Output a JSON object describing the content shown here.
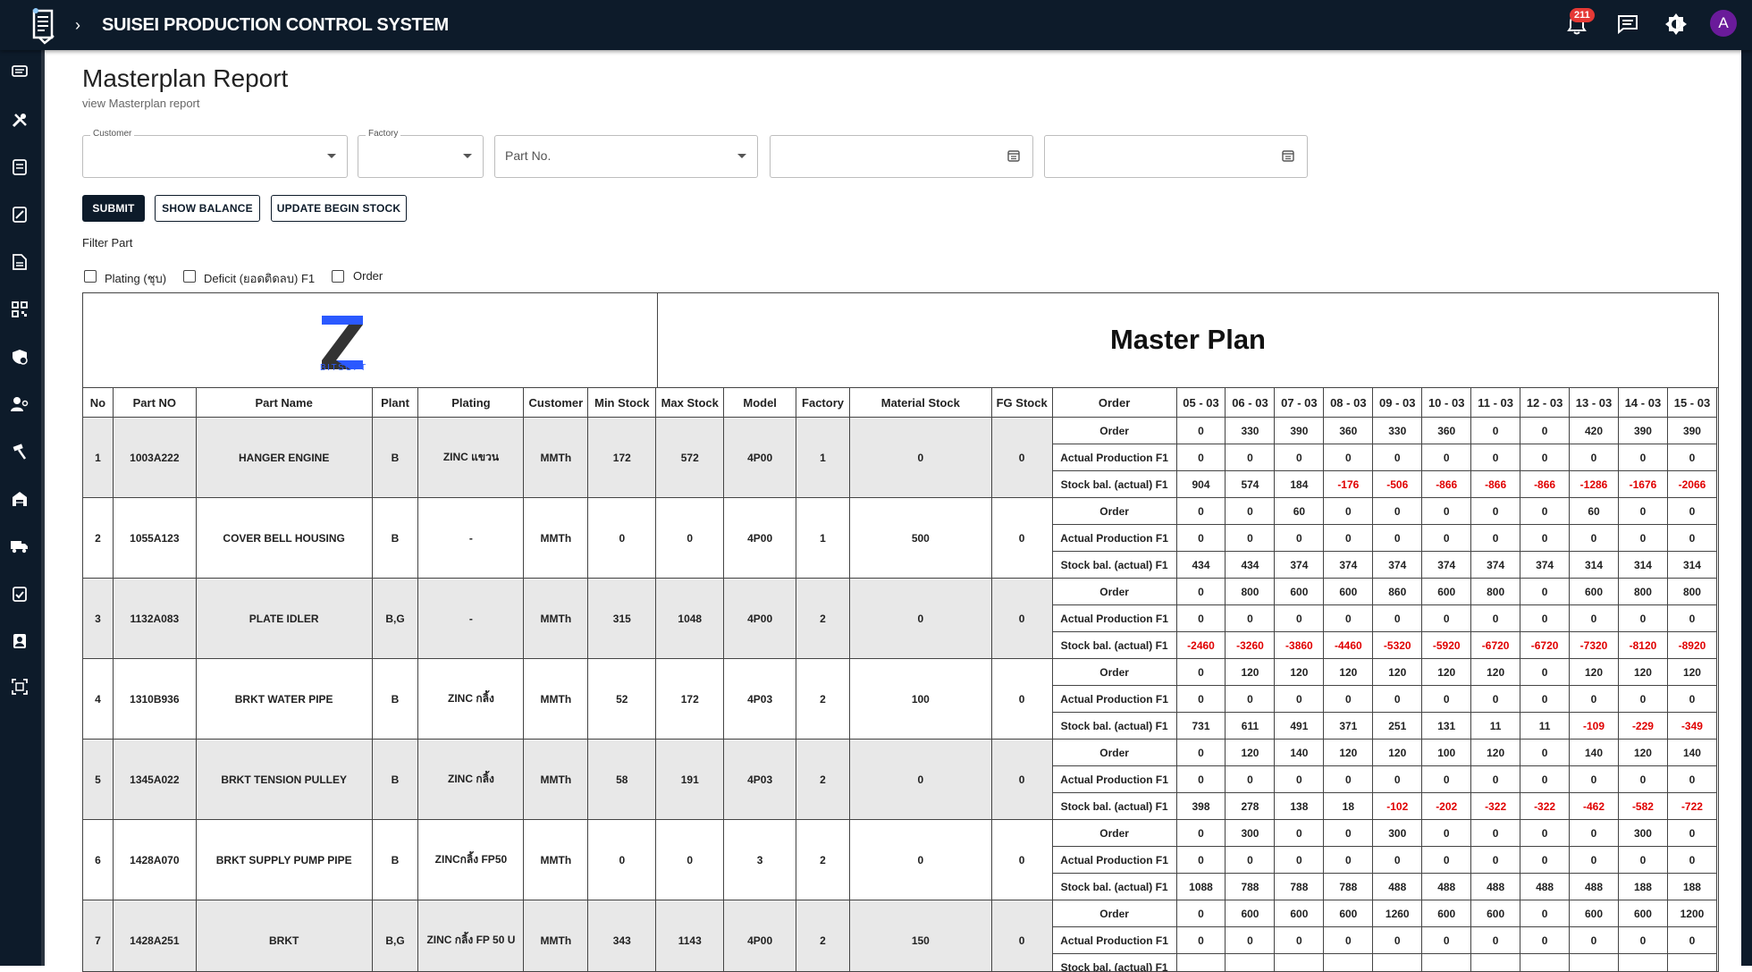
{
  "header": {
    "title": "SUISEI PRODUCTION CONTROL SYSTEM",
    "notification_count": "211",
    "avatar_letter": "A"
  },
  "page": {
    "title": "Masterplan Report",
    "subtitle": "view Masterplan report"
  },
  "filters": {
    "customer_label": "Customer",
    "factory_label": "Factory",
    "part_no_placeholder": "Part No."
  },
  "buttons": {
    "submit": "SUBMIT",
    "show_balance": "SHOW BALANCE",
    "update_begin_stock": "UPDATE BEGIN STOCK"
  },
  "filter_part": {
    "label": "Filter Part",
    "options": [
      "Plating (ชุบ)",
      "Deficit (ยอดติดลบ) F1",
      "Order"
    ]
  },
  "report": {
    "title": "Master Plan",
    "logo_text": "BITSOFT",
    "columns": [
      "No",
      "Part NO",
      "Part Name",
      "Plant",
      "Plating",
      "Customer",
      "Min Stock",
      "Max Stock",
      "Model",
      "Factory",
      "Material Stock",
      "FG Stock",
      "Order"
    ],
    "dates": [
      "05 - 03",
      "06 - 03",
      "07 - 03",
      "08 - 03",
      "09 - 03",
      "10 - 03",
      "11 - 03",
      "12 - 03",
      "13 - 03",
      "14 - 03",
      "15 - 03"
    ],
    "row_labels": [
      "Order",
      "Actual Production F1",
      "Stock bal. (actual) F1"
    ],
    "parts": [
      {
        "no": "1",
        "part_no": "1003A222",
        "name": "HANGER ENGINE",
        "plant": "B",
        "plating": "ZINC แขวน",
        "customer": "MMTh",
        "min": "172",
        "max": "572",
        "model": "4P00",
        "factory": "1",
        "material": "0",
        "fg": "0",
        "rows": [
          [
            "0",
            "330",
            "390",
            "360",
            "330",
            "360",
            "0",
            "0",
            "420",
            "390",
            "390"
          ],
          [
            "0",
            "0",
            "0",
            "0",
            "0",
            "0",
            "0",
            "0",
            "0",
            "0",
            "0"
          ],
          [
            "904",
            "574",
            "184",
            "-176",
            "-506",
            "-866",
            "-866",
            "-866",
            "-1286",
            "-1676",
            "-2066"
          ]
        ]
      },
      {
        "no": "2",
        "part_no": "1055A123",
        "name": "COVER BELL HOUSING",
        "plant": "B",
        "plating": "-",
        "customer": "MMTh",
        "min": "0",
        "max": "0",
        "model": "4P00",
        "factory": "1",
        "material": "500",
        "fg": "0",
        "rows": [
          [
            "0",
            "0",
            "60",
            "0",
            "0",
            "0",
            "0",
            "0",
            "60",
            "0",
            "0"
          ],
          [
            "0",
            "0",
            "0",
            "0",
            "0",
            "0",
            "0",
            "0",
            "0",
            "0",
            "0"
          ],
          [
            "434",
            "434",
            "374",
            "374",
            "374",
            "374",
            "374",
            "374",
            "314",
            "314",
            "314"
          ]
        ]
      },
      {
        "no": "3",
        "part_no": "1132A083",
        "name": "PLATE IDLER",
        "plant": "B,G",
        "plating": "-",
        "customer": "MMTh",
        "min": "315",
        "max": "1048",
        "model": "4P00",
        "factory": "2",
        "material": "0",
        "fg": "0",
        "rows": [
          [
            "0",
            "800",
            "600",
            "600",
            "860",
            "600",
            "800",
            "0",
            "600",
            "800",
            "800"
          ],
          [
            "0",
            "0",
            "0",
            "0",
            "0",
            "0",
            "0",
            "0",
            "0",
            "0",
            "0"
          ],
          [
            "-2460",
            "-3260",
            "-3860",
            "-4460",
            "-5320",
            "-5920",
            "-6720",
            "-6720",
            "-7320",
            "-8120",
            "-8920"
          ]
        ]
      },
      {
        "no": "4",
        "part_no": "1310B936",
        "name": "BRKT WATER PIPE",
        "plant": "B",
        "plating": "ZINC กลิ้ง",
        "customer": "MMTh",
        "min": "52",
        "max": "172",
        "model": "4P03",
        "factory": "2",
        "material": "100",
        "fg": "0",
        "rows": [
          [
            "0",
            "120",
            "120",
            "120",
            "120",
            "120",
            "120",
            "0",
            "120",
            "120",
            "120"
          ],
          [
            "0",
            "0",
            "0",
            "0",
            "0",
            "0",
            "0",
            "0",
            "0",
            "0",
            "0"
          ],
          [
            "731",
            "611",
            "491",
            "371",
            "251",
            "131",
            "11",
            "11",
            "-109",
            "-229",
            "-349"
          ]
        ]
      },
      {
        "no": "5",
        "part_no": "1345A022",
        "name": "BRKT TENSION PULLEY",
        "plant": "B",
        "plating": "ZINC กลิ้ง",
        "customer": "MMTh",
        "min": "58",
        "max": "191",
        "model": "4P03",
        "factory": "2",
        "material": "0",
        "fg": "0",
        "rows": [
          [
            "0",
            "120",
            "140",
            "120",
            "120",
            "100",
            "120",
            "0",
            "140",
            "120",
            "140"
          ],
          [
            "0",
            "0",
            "0",
            "0",
            "0",
            "0",
            "0",
            "0",
            "0",
            "0",
            "0"
          ],
          [
            "398",
            "278",
            "138",
            "18",
            "-102",
            "-202",
            "-322",
            "-322",
            "-462",
            "-582",
            "-722"
          ]
        ]
      },
      {
        "no": "6",
        "part_no": "1428A070",
        "name": "BRKT SUPPLY PUMP PIPE",
        "plant": "B",
        "plating": "ZINCกลิ้ง FP50",
        "customer": "MMTh",
        "min": "0",
        "max": "0",
        "model": "3",
        "factory": "2",
        "material": "0",
        "fg": "0",
        "rows": [
          [
            "0",
            "300",
            "0",
            "0",
            "300",
            "0",
            "0",
            "0",
            "0",
            "300",
            "0"
          ],
          [
            "0",
            "0",
            "0",
            "0",
            "0",
            "0",
            "0",
            "0",
            "0",
            "0",
            "0"
          ],
          [
            "1088",
            "788",
            "788",
            "788",
            "488",
            "488",
            "488",
            "488",
            "488",
            "188",
            "188"
          ]
        ]
      },
      {
        "no": "7",
        "part_no": "1428A251",
        "name": "BRKT",
        "plant": "B,G",
        "plating": "ZINC กลิ้ง FP 50 U",
        "customer": "MMTh",
        "min": "343",
        "max": "1143",
        "model": "4P00",
        "factory": "2",
        "material": "150",
        "fg": "0",
        "rows": [
          [
            "0",
            "600",
            "600",
            "600",
            "1260",
            "600",
            "600",
            "0",
            "600",
            "600",
            "1200"
          ],
          [
            "0",
            "0",
            "0",
            "0",
            "0",
            "0",
            "0",
            "0",
            "0",
            "0",
            "0"
          ],
          [
            "",
            "",
            "",
            "",
            "",
            "",
            "",
            "",
            "",
            "",
            ""
          ]
        ]
      }
    ]
  },
  "icons": {
    "sidebar": [
      "chat-icon",
      "tools-icon",
      "document-icon",
      "edit-icon",
      "file-icon",
      "qr-icon",
      "shield-icon",
      "users-icon",
      "hammer-icon",
      "warehouse-icon",
      "truck-icon",
      "checklist-icon",
      "id-card-icon",
      "scan-icon"
    ]
  },
  "colors": {
    "primary": "#0d1b2a",
    "negative": "#e00000",
    "badge": "#e53935"
  }
}
